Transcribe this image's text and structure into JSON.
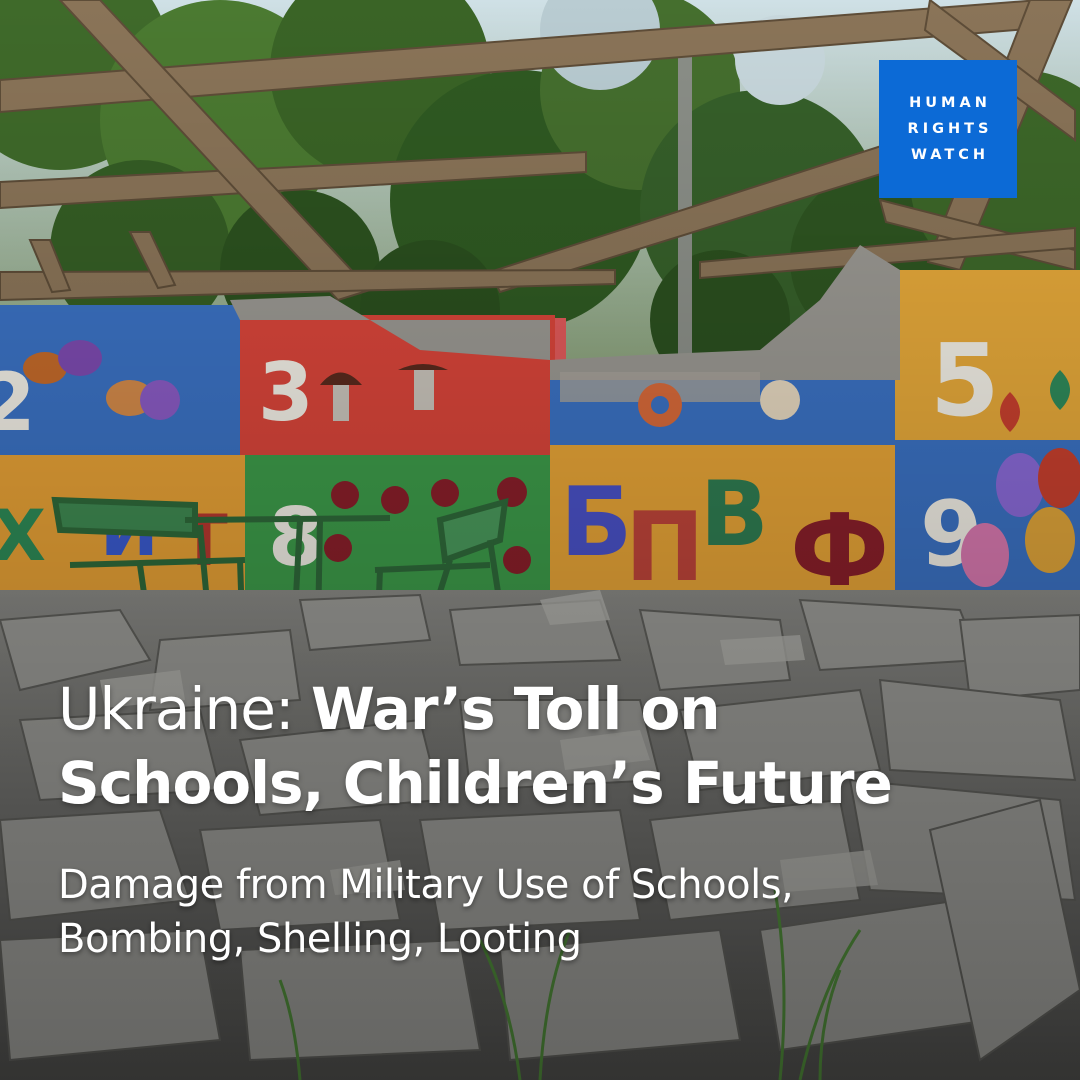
{
  "logo": {
    "line1": "HUMAN",
    "line2": "RIGHTS",
    "line3": "WATCH",
    "color": "#0c6ad6"
  },
  "headline": {
    "prefix": "Ukraine: ",
    "bold_line1": "War’s Toll on",
    "bold_line2": "Schools, Children’s Future"
  },
  "subhead": {
    "line1": "Damage from Military Use of Schools,",
    "line2": "Bombing, Shelling, Looting"
  },
  "mural": {
    "numbers": [
      "2",
      "3",
      "5",
      "8",
      "9"
    ],
    "letters": [
      "Х",
      "И",
      "Т",
      "Б",
      "П",
      "В",
      "Ф"
    ]
  }
}
